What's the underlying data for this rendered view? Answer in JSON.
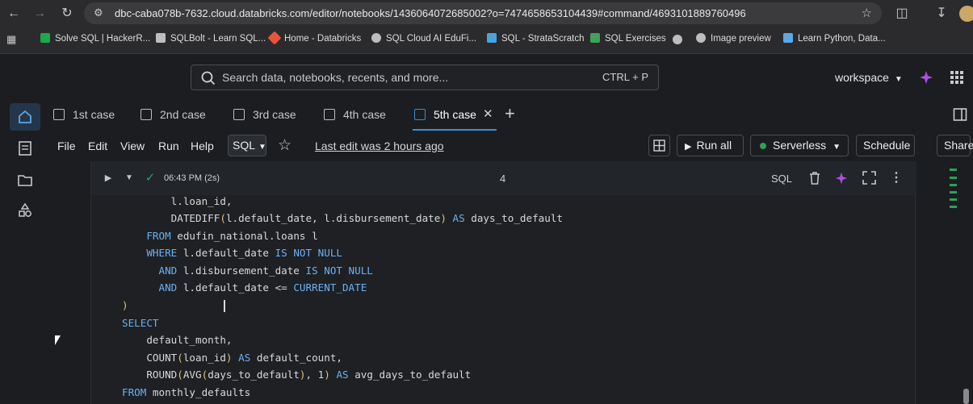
{
  "browser": {
    "url": "dbc-caba078b-7632.cloud.databricks.com/editor/notebooks/1436064072685002?o=7474658653104439#command/4693101889760496"
  },
  "bookmarks": [
    {
      "label": "Solve SQL | HackerR...",
      "color": "#1ba94c"
    },
    {
      "label": "SQLBolt - Learn SQL...",
      "color": "#bdbdbd"
    },
    {
      "label": "Home - Databricks",
      "color": "#e8553b"
    },
    {
      "label": "SQL Cloud AI EduFi...",
      "color": "#bdbdbd"
    },
    {
      "label": "SQL - StrataScratch",
      "color": "#4aa3df"
    },
    {
      "label": "SQL Exercises",
      "color": "#3ea35c"
    },
    {
      "label": "Image preview",
      "color": "#bdbdbd"
    },
    {
      "label": "Learn Python, Data...",
      "color": "#5aa9e6"
    }
  ],
  "header": {
    "search_placeholder": "Search data, notebooks, recents, and more...",
    "search_shortcut": "CTRL + P",
    "workspace_label": "workspace"
  },
  "tabs": [
    {
      "label": "1st case"
    },
    {
      "label": "2nd case"
    },
    {
      "label": "3rd case"
    },
    {
      "label": "4th case"
    },
    {
      "label": "5th case",
      "active": true
    }
  ],
  "menubar": {
    "file": "File",
    "edit": "Edit",
    "view": "View",
    "run": "Run",
    "help": "Help",
    "language": "SQL",
    "last_edit": "Last edit was 2 hours ago",
    "run_all": "Run all",
    "compute": "Serverless",
    "schedule": "Schedule",
    "share": "Share"
  },
  "cell": {
    "run_time": "06:43 PM (2s)",
    "cell_number": "4",
    "language": "SQL"
  },
  "code_lines": [
    "        l.loan_id,",
    "        DATEDIFF(l.default_date, l.disbursement_date) AS days_to_default",
    "    FROM edufin_national.loans l",
    "    WHERE l.default_date IS NOT NULL",
    "      AND l.disbursement_date IS NOT NULL",
    "      AND l.default_date <= CURRENT_DATE",
    ")",
    "SELECT",
    "    default_month,",
    "    COUNT(loan_id) AS default_count,",
    "    ROUND(AVG(days_to_default), 1) AS avg_days_to_default",
    "FROM monthly_defaults"
  ],
  "colors": {
    "keyword": "#6cb0f2",
    "paren": "#e0c07a",
    "accent_tab": "#3b8dd6",
    "status_green": "#2ea05a"
  }
}
